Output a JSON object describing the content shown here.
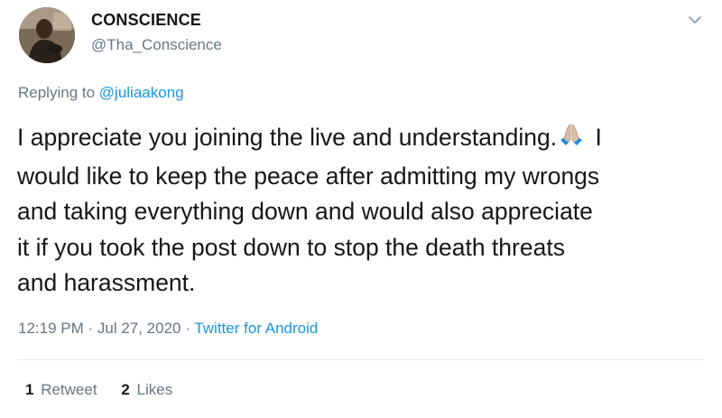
{
  "user": {
    "name": "CONSCIENCE",
    "handle": "@Tha_Conscience"
  },
  "reply": {
    "prefix": "Replying to ",
    "mention": "@juliaakong"
  },
  "tweet": {
    "lines": [
      "I appreciate you joining the live and understanding.",
      " I",
      "would like to keep the peace after admitting my wrongs",
      "and taking everything down and would also appreciate",
      "it if you took the post down to stop the death threats",
      "and harassment."
    ],
    "emoji_icon": "folded-hands-emoji"
  },
  "meta": {
    "time": "12:19 PM",
    "separator": " · ",
    "date": "Jul 27, 2020",
    "source": "Twitter for Android"
  },
  "stats": {
    "retweets_count": "1",
    "retweets_label": "Retweet",
    "likes_count": "2",
    "likes_label": "Likes"
  },
  "colors": {
    "text": "#14171a",
    "secondary": "#657786",
    "link": "#1b95e0",
    "divider": "#e6ecf0"
  }
}
